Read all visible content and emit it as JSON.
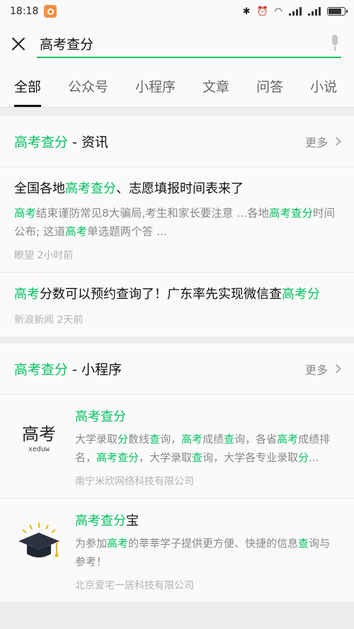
{
  "status": {
    "time": "18:18"
  },
  "search": {
    "query": "高考查分"
  },
  "tabs": [
    "全部",
    "公众号",
    "小程序",
    "文章",
    "问答",
    "小说"
  ],
  "news": {
    "title_hl": "高考查分",
    "title_rest": " - 资讯",
    "more": "更多",
    "items": [
      {
        "t1": "全国各地",
        "t2": "高考查分",
        "t3": "、志愿填报时间表来了",
        "d1": "高考",
        "d2": "结束谨防常见8大骗局,考生和家长要注意 ...各地",
        "d3": "高考查分",
        "d4": "时间公布; 这道",
        "d5": "高考",
        "d6": "单选题两个答 ...",
        "meta": "瞭望 2小时前"
      },
      {
        "t1": "高考",
        "t2": "分数可以预约查询了！广东率先实现微信查",
        "t3": "高考分",
        "meta": "新浪新闻 2天前"
      }
    ]
  },
  "mini": {
    "title_hl": "高考查分",
    "title_rest": " - 小程序",
    "more": "更多",
    "items": [
      {
        "name_hl": "高考查分",
        "name_rest": "",
        "logo_text": "高考",
        "logo_sub": "xeduw",
        "d1": "大学录取",
        "d2": "分",
        "d3": "数线",
        "d4": "查",
        "d5": "询，",
        "d6": "高考",
        "d7": "成绩",
        "d8": "查",
        "d9": "询，各省",
        "d10": "高考",
        "d11": "成绩排名，",
        "d12": "高考查分",
        "d13": "，大学录取",
        "d14": "查",
        "d15": "询，大学各专业录取",
        "d16": "分",
        "d17": "...",
        "org": "南宁米欣网络科技有限公司"
      },
      {
        "name_hl": "高考查分",
        "name_rest": "宝",
        "d1": "为参加",
        "d2": "高考",
        "d3": "的莘莘学子提供更方便、快捷的信息",
        "d4": "查",
        "d5": "询与参考！",
        "org": "北京爱宅一居科技有限公司"
      }
    ]
  }
}
